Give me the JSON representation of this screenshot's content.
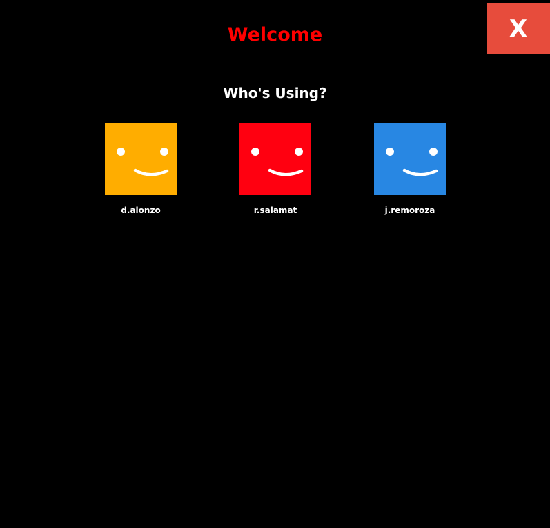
{
  "header": {
    "title": "Welcome",
    "title_color": "#ff0000",
    "close_label": "X",
    "close_color": "#e74c3c"
  },
  "main": {
    "prompt": "Who's Using?",
    "profiles": [
      {
        "name": "d.alonzo",
        "color": "#ffad00",
        "icon": "smiley-face-icon"
      },
      {
        "name": "r.salamat",
        "color": "#ff0010",
        "icon": "smiley-face-icon"
      },
      {
        "name": "j.remoroza",
        "color": "#2887e3",
        "icon": "smiley-face-icon"
      }
    ]
  }
}
